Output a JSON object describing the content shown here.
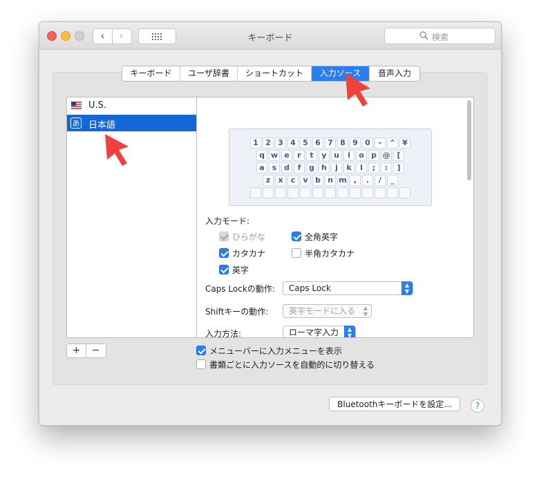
{
  "window": {
    "title": "キーボード"
  },
  "toolbar": {
    "search_placeholder": "検索",
    "back_glyph": "‹",
    "forward_glyph": "›"
  },
  "tabs": [
    {
      "label": "キーボード",
      "active": false
    },
    {
      "label": "ユーザ辞書",
      "active": false
    },
    {
      "label": "ショートカット",
      "active": false
    },
    {
      "label": "入力ソース",
      "active": true
    },
    {
      "label": "音声入力",
      "active": false
    }
  ],
  "sources": [
    {
      "label": "U.S.",
      "icon": "us-flag-icon",
      "selected": false
    },
    {
      "label": "日本語",
      "icon": "japanese-kana-icon",
      "icon_text": "あ",
      "selected": true
    }
  ],
  "keyboard_rows": [
    [
      "1",
      "2",
      "3",
      "4",
      "5",
      "6",
      "7",
      "8",
      "9",
      "0",
      "-",
      "^",
      "¥"
    ],
    [
      "q",
      "w",
      "e",
      "r",
      "t",
      "y",
      "u",
      "i",
      "o",
      "p",
      "@",
      "["
    ],
    [
      "a",
      "s",
      "d",
      "f",
      "g",
      "h",
      "j",
      "k",
      "l",
      ";",
      ":",
      "]"
    ],
    [
      "z",
      "x",
      "c",
      "v",
      "b",
      "n",
      "m",
      ",",
      ".",
      "/",
      "_"
    ]
  ],
  "input_mode": {
    "label": "入力モード:",
    "hiragana": {
      "label": "ひらがな",
      "checked": true,
      "disabled": true
    },
    "katakana": {
      "label": "カタカナ",
      "checked": true
    },
    "eiji": {
      "label": "英字",
      "checked": true
    },
    "zenkaku_eiji": {
      "label": "全角英字",
      "checked": true
    },
    "hankaku_katakana": {
      "label": "半角カタカナ",
      "checked": false
    }
  },
  "caps_lock": {
    "label": "Caps Lockの動作:",
    "value": "Caps Lock"
  },
  "shift": {
    "label": "Shiftキーの動作:",
    "value": "英字モードに入る"
  },
  "input_method": {
    "label": "入力方法:",
    "value": "ローマ字入力"
  },
  "options": {
    "show_menu": {
      "label": "メニューバーに入力メニューを表示",
      "checked": true
    },
    "auto_switch": {
      "label": "書類ごとに入力ソースを自動的に切り替える",
      "checked": false
    }
  },
  "buttons": {
    "plus": "+",
    "minus": "−",
    "bluetooth": "Bluetoothキーボードを設定...",
    "help": "?"
  },
  "colors": {
    "accent": "#2b7ef1",
    "selection": "#1567d6",
    "annotation_arrow": "#f0413f"
  }
}
